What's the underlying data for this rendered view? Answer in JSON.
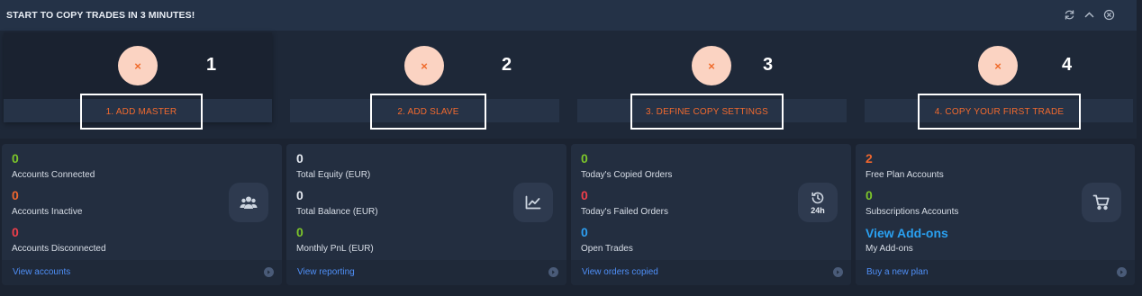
{
  "header": {
    "title": "START TO COPY TRADES IN 3 MINUTES!",
    "icons": [
      "refresh-icon",
      "chevron-up-icon",
      "close-circle-icon"
    ]
  },
  "steps": [
    {
      "icon": "×",
      "number": "1",
      "label": "1. ADD MASTER"
    },
    {
      "icon": "×",
      "number": "2",
      "label": "2. ADD SLAVE"
    },
    {
      "icon": "×",
      "number": "3",
      "label": "3. DEFINE COPY SETTINGS"
    },
    {
      "icon": "×",
      "number": "4",
      "label": "4. COPY YOUR FIRST TRADE"
    }
  ],
  "cards": {
    "accounts": {
      "stats": [
        {
          "value": "0",
          "label": "Accounts Connected",
          "color": "#7cc52a"
        },
        {
          "value": "0",
          "label": "Accounts Inactive",
          "color": "#f0662e"
        },
        {
          "value": "0",
          "label": "Accounts Disconnected",
          "color": "#ef3e4a"
        }
      ],
      "icon": "users-icon",
      "link": "View accounts"
    },
    "equity": {
      "stats": [
        {
          "value": "0",
          "label": "Total Equity (EUR)",
          "color": "#e4e9f0"
        },
        {
          "value": "0",
          "label": "Total Balance (EUR)",
          "color": "#e4e9f0"
        },
        {
          "value": "0",
          "label": "Monthly PnL (EUR)",
          "color": "#7cc52a"
        }
      ],
      "icon": "chart-line-icon",
      "link": "View reporting"
    },
    "orders": {
      "stats": [
        {
          "value": "0",
          "label": "Today's Copied Orders",
          "color": "#7cc52a"
        },
        {
          "value": "0",
          "label": "Today's Failed Orders",
          "color": "#ef3e4a"
        },
        {
          "value": "0",
          "label": "Open Trades",
          "color": "#2d9ef0"
        }
      ],
      "icon": "history-icon",
      "badge_text": "24h",
      "link": "View orders copied"
    },
    "plan": {
      "stats": [
        {
          "value": "2",
          "label": "Free Plan Accounts",
          "color": "#f0662e"
        },
        {
          "value": "0",
          "label": "Subscriptions Accounts",
          "color": "#7cc52a"
        }
      ],
      "addons_link": "View Add-ons",
      "addons_label": "My Add-ons",
      "icon": "cart-icon",
      "link": "Buy a new plan"
    }
  }
}
